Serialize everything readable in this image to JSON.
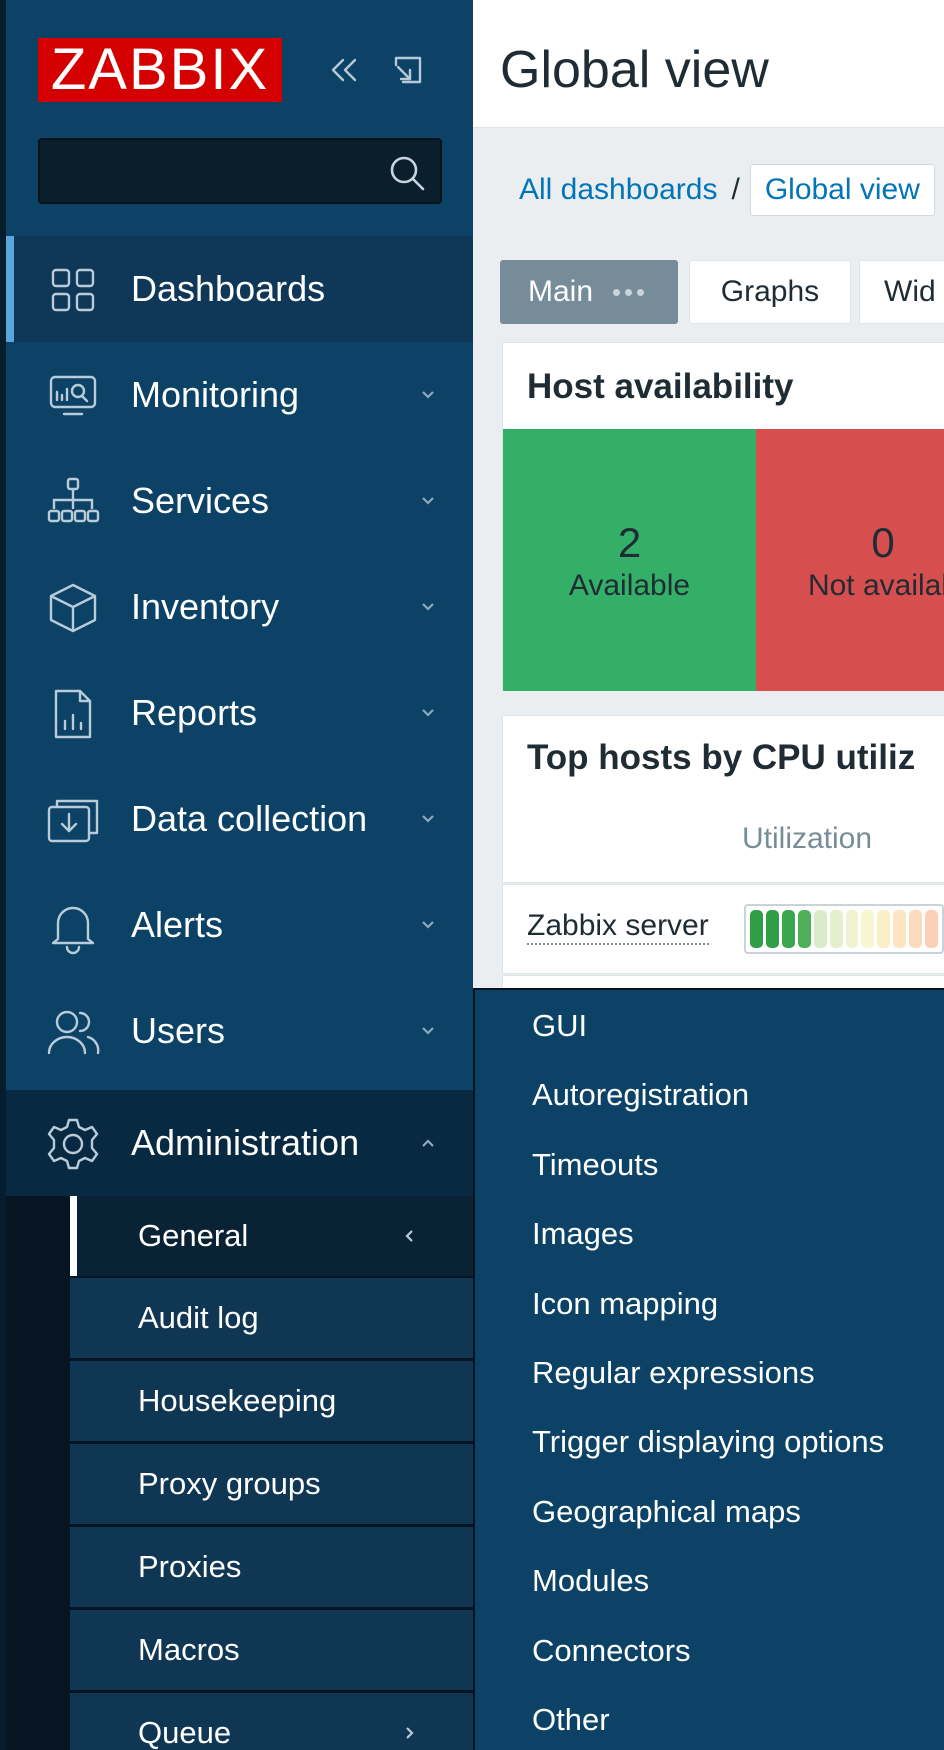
{
  "sidebar": {
    "logo": "ZABBIX",
    "search": {
      "placeholder": "",
      "value": ""
    },
    "items": [
      {
        "label": "Dashboards",
        "icon": "dashboards-icon",
        "state": "active"
      },
      {
        "label": "Monitoring",
        "icon": "monitoring-icon",
        "state": "collapsed"
      },
      {
        "label": "Services",
        "icon": "services-icon",
        "state": "collapsed"
      },
      {
        "label": "Inventory",
        "icon": "inventory-icon",
        "state": "collapsed"
      },
      {
        "label": "Reports",
        "icon": "reports-icon",
        "state": "collapsed"
      },
      {
        "label": "Data collection",
        "icon": "data-collection-icon",
        "state": "collapsed"
      },
      {
        "label": "Alerts",
        "icon": "bell-icon",
        "state": "collapsed"
      },
      {
        "label": "Users",
        "icon": "users-icon",
        "state": "collapsed"
      },
      {
        "label": "Administration",
        "icon": "gear-icon",
        "state": "expanded"
      }
    ],
    "admin_submenu": [
      {
        "label": "General",
        "active": true,
        "chevron": "left"
      },
      {
        "label": "Audit log"
      },
      {
        "label": "Housekeeping"
      },
      {
        "label": "Proxy groups"
      },
      {
        "label": "Proxies"
      },
      {
        "label": "Macros"
      },
      {
        "label": "Queue",
        "chevron": "right"
      }
    ]
  },
  "header": {
    "title": "Global view"
  },
  "breadcrumb": {
    "root": "All dashboards",
    "separator": "/",
    "current": "Global view"
  },
  "tabs": [
    {
      "label": "Main",
      "active": true
    },
    {
      "label": "Graphs"
    },
    {
      "label": "Wid"
    }
  ],
  "host_availability": {
    "title": "Host availability",
    "cells": [
      {
        "count": "2",
        "label": "Available",
        "color": "#34af67"
      },
      {
        "count": "0",
        "label": "Not availab",
        "color": "#d64e4e"
      }
    ]
  },
  "top_hosts": {
    "title": "Top hosts by CPU utiliz",
    "column_header": "Utilization",
    "rows": [
      {
        "host": "Zabbix server",
        "utilization_fraction": 0.3
      }
    ]
  },
  "flyout_menu": {
    "items": [
      "GUI",
      "Autoregistration",
      "Timeouts",
      "Images",
      "Icon mapping",
      "Regular expressions",
      "Trigger displaying options",
      "Geographical maps",
      "Modules",
      "Connectors",
      "Other"
    ]
  },
  "colors": {
    "sidebar_bg": "#0b4266",
    "accent_blue": "#0275b8",
    "available_green": "#34af67",
    "unavailable_red": "#d64e4e",
    "logo_red": "#d40000"
  }
}
